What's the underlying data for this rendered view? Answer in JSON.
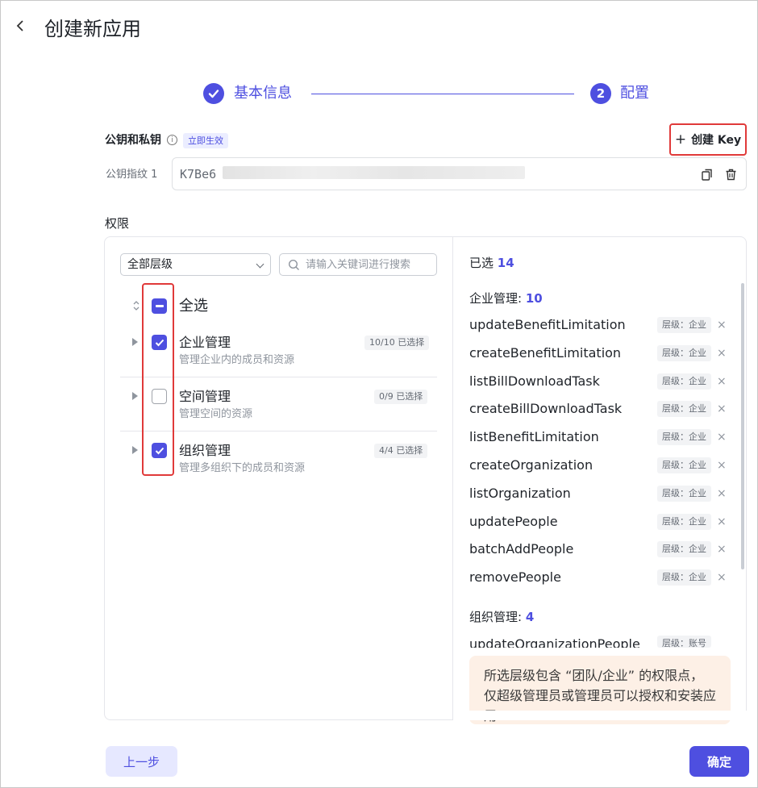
{
  "header": {
    "title": "创建新应用",
    "back_icon": "chevron-left-icon"
  },
  "steps": [
    {
      "label": "基本信息",
      "state": "done",
      "marker": "✓"
    },
    {
      "label": "配置",
      "state": "active",
      "marker": "2"
    }
  ],
  "keys": {
    "section_label": "公钥和私钥",
    "badge": "立即生效",
    "create_label": "创建 Key",
    "fingerprint_label": "公钥指纹 1",
    "fingerprint_value": "K7Be6"
  },
  "permissions": {
    "title": "权限",
    "level_select": "全部层级",
    "search_placeholder": "请输入关键词进行搜索",
    "select_all": "全选",
    "groups": [
      {
        "name": "企业管理",
        "desc": "管理企业内的成员和资源",
        "count": "10/10 已选择",
        "checked": true
      },
      {
        "name": "空间管理",
        "desc": "管理空间的资源",
        "count": "0/9 已选择",
        "checked": false
      },
      {
        "name": "组织管理",
        "desc": "管理多组织下的成员和资源",
        "count": "4/4 已选择",
        "checked": true
      }
    ]
  },
  "selected": {
    "label": "已选",
    "total": "14",
    "categories": [
      {
        "name": "企业管理:",
        "count": "10",
        "items": [
          {
            "api": "updateBenefitLimitation",
            "tag": "层级：企业"
          },
          {
            "api": "createBenefitLimitation",
            "tag": "层级：企业"
          },
          {
            "api": "listBillDownloadTask",
            "tag": "层级：企业"
          },
          {
            "api": "createBillDownloadTask",
            "tag": "层级：企业"
          },
          {
            "api": "listBenefitLimitation",
            "tag": "层级：企业"
          },
          {
            "api": "createOrganization",
            "tag": "层级：企业"
          },
          {
            "api": "listOrganization",
            "tag": "层级：企业"
          },
          {
            "api": "updatePeople",
            "tag": "层级：企业"
          },
          {
            "api": "batchAddPeople",
            "tag": "层级：企业"
          },
          {
            "api": "removePeople",
            "tag": "层级：企业"
          }
        ]
      },
      {
        "name": "组织管理:",
        "count": "4",
        "items": [
          {
            "api": "updateOrganizationPeople",
            "tag": "层级：账号"
          }
        ]
      }
    ],
    "warning": "所选层级包含 “团队/企业” 的权限点，仅超级管理员或管理员可以授权和安装应用"
  },
  "footer": {
    "prev_label": "上一步",
    "confirm_label": "确定"
  },
  "colors": {
    "accent": "#4e4fe0",
    "highlight": "#e03a3a"
  }
}
